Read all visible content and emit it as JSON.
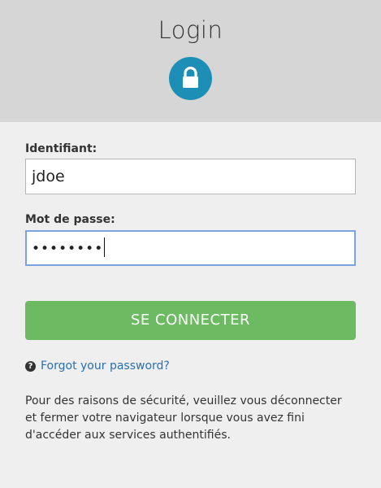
{
  "header": {
    "title": "Login",
    "icon": "lock-icon",
    "icon_bg": "#1d8fb6"
  },
  "form": {
    "username_label": "Identifiant:",
    "username_value": "jdoe",
    "password_label": "Mot de passe:",
    "password_masked": "••••••••",
    "submit_label": "SE CONNECTER",
    "submit_color": "#6cba61"
  },
  "links": {
    "forgot_icon": "question-circle-icon",
    "forgot_label": "Forgot your password?"
  },
  "notice": {
    "text": "Pour des raisons de sécurité, veuillez vous déconnecter et fermer votre navigateur lorsque vous avez fini d'accéder aux services authentifiés."
  }
}
